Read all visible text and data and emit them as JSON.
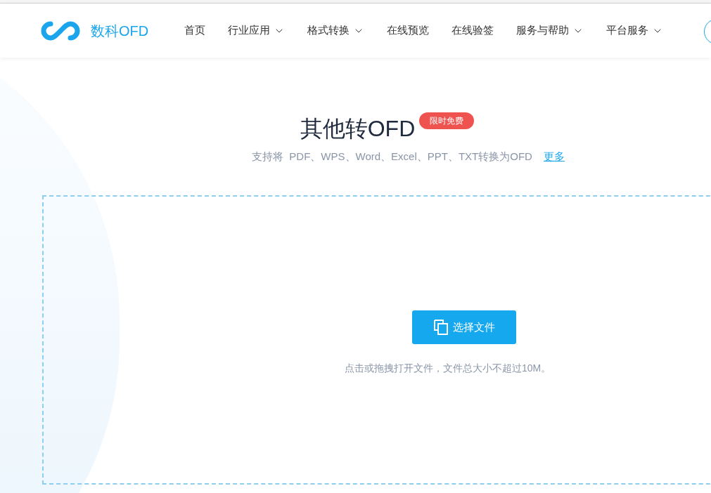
{
  "header": {
    "logo_text": "数科OFD",
    "nav": [
      {
        "label": "首页",
        "dropdown": false
      },
      {
        "label": "行业应用",
        "dropdown": true
      },
      {
        "label": "格式转换",
        "dropdown": true
      },
      {
        "label": "在线预览",
        "dropdown": false
      },
      {
        "label": "在线验签",
        "dropdown": false
      },
      {
        "label": "服务与帮助",
        "dropdown": true
      },
      {
        "label": "平台服务",
        "dropdown": true
      }
    ]
  },
  "hero": {
    "title": "其他转OFD",
    "badge": "限时免费",
    "subtitle": "支持将  PDF、WPS、Word、Excel、PPT、TXT转换为OFD",
    "more_link": "更多"
  },
  "upload": {
    "button": "选择文件",
    "hint": "点击或拖拽打开文件，文件总大小不超过10M。"
  }
}
